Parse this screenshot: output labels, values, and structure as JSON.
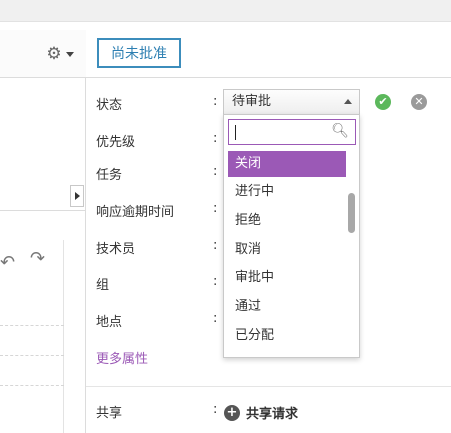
{
  "toolbar": {
    "approval_button_label": "尚未批准"
  },
  "icons": {
    "gear": "gear-icon",
    "undo": "undo-icon",
    "redo": "redo-icon",
    "search": "search-icon",
    "confirm": "check-circle-icon",
    "cancel": "close-circle-icon",
    "add": "plus-circle-icon"
  },
  "fields": [
    {
      "label": "状态",
      "colon": ":"
    },
    {
      "label": "优先级",
      "colon": ":"
    },
    {
      "label": "任务",
      "colon": ":"
    },
    {
      "label": "响应逾期时间",
      "colon": ":"
    },
    {
      "label": "技术员",
      "colon": ":"
    },
    {
      "label": "组",
      "colon": ":"
    },
    {
      "label": "地点",
      "colon": ":"
    }
  ],
  "status_select": {
    "current_value": "待审批",
    "search_placeholder": "",
    "options": [
      {
        "label": "关闭",
        "selected": true
      },
      {
        "label": "进行中",
        "selected": false
      },
      {
        "label": "拒绝",
        "selected": false
      },
      {
        "label": "取消",
        "selected": false
      },
      {
        "label": "审批中",
        "selected": false
      },
      {
        "label": "通过",
        "selected": false
      },
      {
        "label": "已分配",
        "selected": false
      }
    ]
  },
  "more_attributes_label": "更多属性",
  "share": {
    "label": "共享",
    "colon": ":",
    "add_label": "共享请求"
  },
  "colors": {
    "accent_purple": "#9b59b6",
    "approval_blue": "#3c8dbc",
    "confirm_green": "#5cb85c",
    "cancel_gray": "#9a9a9a"
  }
}
